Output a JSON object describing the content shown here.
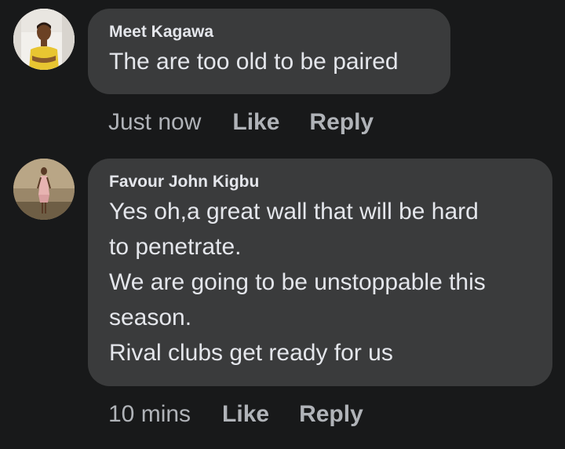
{
  "comments": [
    {
      "author": "Meet Kagawa",
      "text": "The are too old to be paired",
      "time": "Just now",
      "like_label": "Like",
      "reply_label": "Reply"
    },
    {
      "author": "Favour John Kigbu",
      "text_lines": [
        "Yes oh,a great wall that will be hard",
        "to penetrate.",
        "We are going to be unstoppable this",
        "season.",
        "Rival clubs get ready for us"
      ],
      "time": "10 mins",
      "like_label": "Like",
      "reply_label": "Reply"
    }
  ]
}
